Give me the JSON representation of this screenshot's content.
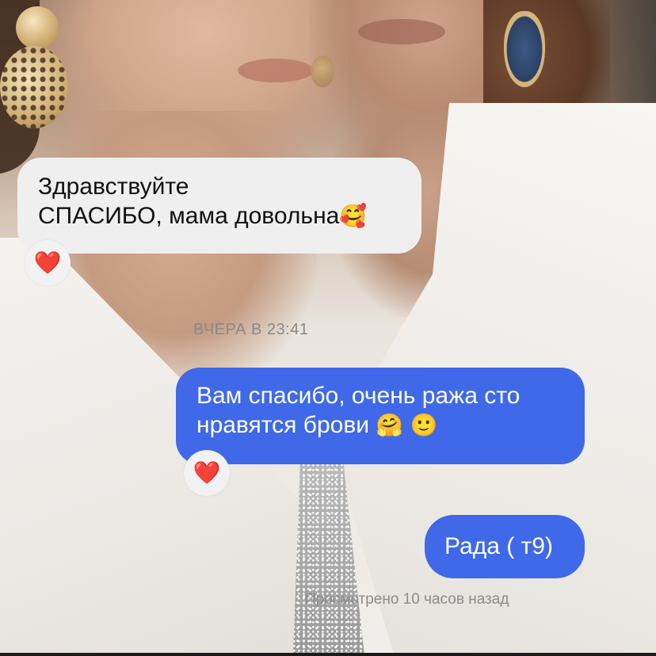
{
  "chat": {
    "messages": [
      {
        "direction": "incoming",
        "lines": [
          "Здравствуйте",
          "СПАСИБО, мама довольна"
        ],
        "emojis": [
          "smiling-face-with-hearts"
        ],
        "reaction": "❤️"
      },
      {
        "direction": "outgoing",
        "lines": [
          "Вам спасибо, очень ража сто",
          "нравятся брови"
        ],
        "emojis": [
          "hugging-face",
          "slightly-smiling-face"
        ],
        "reaction": "❤️"
      },
      {
        "direction": "outgoing",
        "lines": [
          "Рада ( т9)"
        ]
      }
    ],
    "timestamp": "ВЧЕРА В 23:41",
    "read_receipt": "Просмотрено 10 часов назад"
  },
  "colors": {
    "incoming_bubble": "#efefef",
    "outgoing_bubble": "#3f69e8",
    "heart": "#e8232f",
    "meta_text": "#8a8a8a"
  },
  "emoji_glyphs": {
    "smiling-face-with-hearts": "🥰",
    "hugging-face": "🤗",
    "slightly-smiling-face": "🙂"
  }
}
